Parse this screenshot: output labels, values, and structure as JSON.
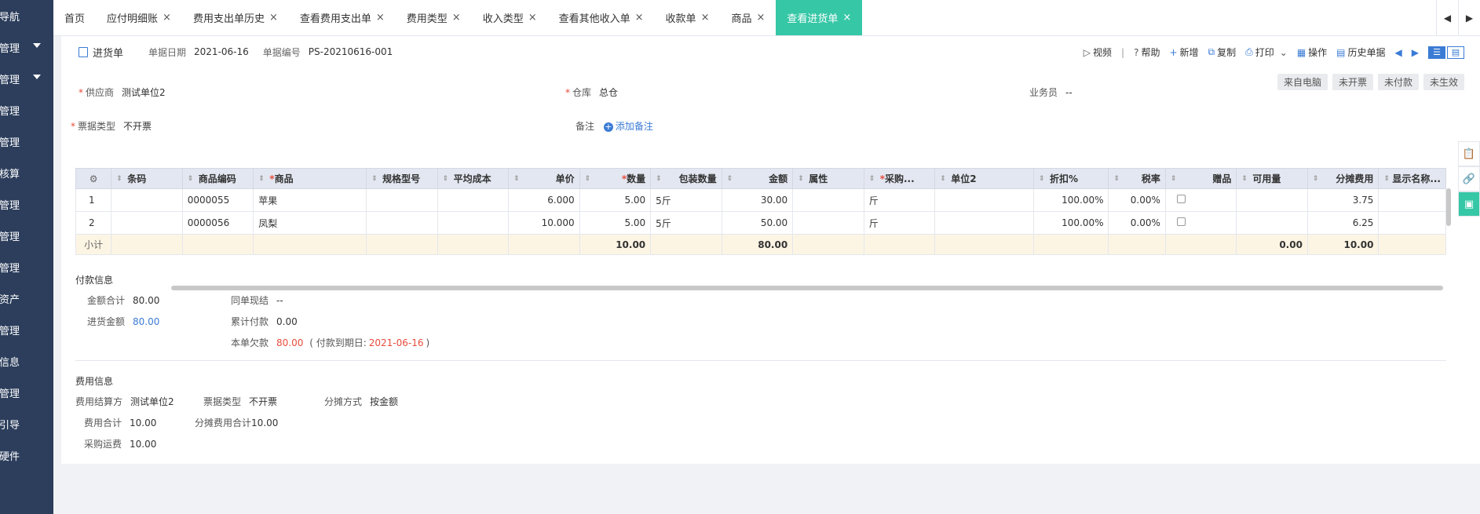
{
  "sidebar": {
    "items": [
      {
        "label": "快导航",
        "caret": false
      },
      {
        "label": "购管理",
        "caret": true
      },
      {
        "label": "货管理",
        "caret": true
      },
      {
        "label": "存管理",
        "caret": false
      },
      {
        "label": "务管理",
        "caret": false
      },
      {
        "label": "本核算",
        "caret": false
      },
      {
        "label": "金管理",
        "caret": false
      },
      {
        "label": "账管理",
        "caret": false
      },
      {
        "label": "务管理",
        "caret": false
      },
      {
        "label": "定资产",
        "caret": false
      },
      {
        "label": "管管理",
        "caret": false
      },
      {
        "label": "础信息",
        "caret": false
      },
      {
        "label": "统管理",
        "caret": false
      },
      {
        "label": "手引导",
        "caret": false
      },
      {
        "label": "联硬件",
        "caret": false
      }
    ]
  },
  "tabs": [
    {
      "label": "首页",
      "closable": false,
      "active": false
    },
    {
      "label": "应付明细账",
      "closable": true,
      "active": false
    },
    {
      "label": "费用支出单历史",
      "closable": true,
      "active": false
    },
    {
      "label": "查看费用支出单",
      "closable": true,
      "active": false
    },
    {
      "label": "费用类型",
      "closable": true,
      "active": false
    },
    {
      "label": "收入类型",
      "closable": true,
      "active": false
    },
    {
      "label": "查看其他收入单",
      "closable": true,
      "active": false
    },
    {
      "label": "收款单",
      "closable": true,
      "active": false
    },
    {
      "label": "商品",
      "closable": true,
      "active": false
    },
    {
      "label": "查看进货单",
      "closable": true,
      "active": true
    }
  ],
  "tab_nav": {
    "left": "◀",
    "right": "▶"
  },
  "doc": {
    "title": "进货单",
    "date_label": "单据日期",
    "date": "2021-06-16",
    "no_label": "单据编号",
    "no": "PS-20210616-001"
  },
  "toolbar": {
    "video": "视频",
    "help": "帮助",
    "new": "新增",
    "copy": "复制",
    "print": "打印",
    "ops": "操作",
    "history": "历史单据"
  },
  "status_badges": [
    "来自电脑",
    "未开票",
    "未付款",
    "未生效"
  ],
  "form": {
    "supplier_label": "供应商",
    "supplier": "测试单位2",
    "warehouse_label": "仓库",
    "warehouse": "总仓",
    "salesman_label": "业务员",
    "salesman": "--",
    "invoice_label": "票据类型",
    "invoice": "不开票",
    "note_label": "备注",
    "add_note": "添加备注"
  },
  "grid": {
    "columns": [
      "",
      "条码",
      "商品编码",
      "商品",
      "规格型号",
      "平均成本",
      "单价",
      "数量",
      "包装数量",
      "金额",
      "属性",
      "采购...",
      "单位2",
      "折扣%",
      "税率",
      "赠品",
      "可用量",
      "分摊费用",
      "显示名称..."
    ],
    "required_columns": [
      "商品",
      "数量",
      "采购..."
    ],
    "rows": [
      {
        "idx": "1",
        "barcode": "",
        "code": "0000055",
        "name": "苹果",
        "spec": "",
        "avg_cost": "",
        "price": "6.000",
        "qty": "5.00",
        "pack_qty": "5斤",
        "amount": "30.00",
        "attr": "",
        "purchase_unit": "斤",
        "unit2": "",
        "discount": "100.00%",
        "tax": "0.00%",
        "avail": "",
        "alloc": "3.75",
        "display": ""
      },
      {
        "idx": "2",
        "barcode": "",
        "code": "0000056",
        "name": "凤梨",
        "spec": "",
        "avg_cost": "",
        "price": "10.000",
        "qty": "5.00",
        "pack_qty": "5斤",
        "amount": "50.00",
        "attr": "",
        "purchase_unit": "斤",
        "unit2": "",
        "discount": "100.00%",
        "tax": "0.00%",
        "avail": "",
        "alloc": "6.25",
        "display": ""
      }
    ],
    "subtotal": {
      "label": "小计",
      "qty": "10.00",
      "amount": "80.00",
      "avail": "0.00",
      "alloc": "10.00"
    }
  },
  "payment": {
    "title": "付款信息",
    "total_label": "金额合计",
    "total": "80.00",
    "cash_label": "同单现结",
    "cash": "--",
    "purchase_label": "进货金额",
    "purchase": "80.00",
    "paid_label": "累计付款",
    "paid": "0.00",
    "owed_label": "本单欠款",
    "owed": "80.00",
    "due_prefix": "( 付款到期日:",
    "due_date": "2021-06-16",
    "due_suffix": ")"
  },
  "expense": {
    "title": "费用信息",
    "settle_label": "费用结算方",
    "settle": "测试单位2",
    "invoice_label": "票据类型",
    "invoice": "不开票",
    "method_label": "分摊方式",
    "method": "按金额",
    "total_label": "费用合计",
    "total": "10.00",
    "alloc_total_label": "分摊费用合计",
    "alloc_total": "10.00",
    "freight_label": "采购运费",
    "freight": "10.00"
  },
  "colors": {
    "accent": "#36c7a6",
    "link": "#3a7bd5",
    "required": "#e74c3c",
    "sidebar": "#2c3e5c"
  }
}
